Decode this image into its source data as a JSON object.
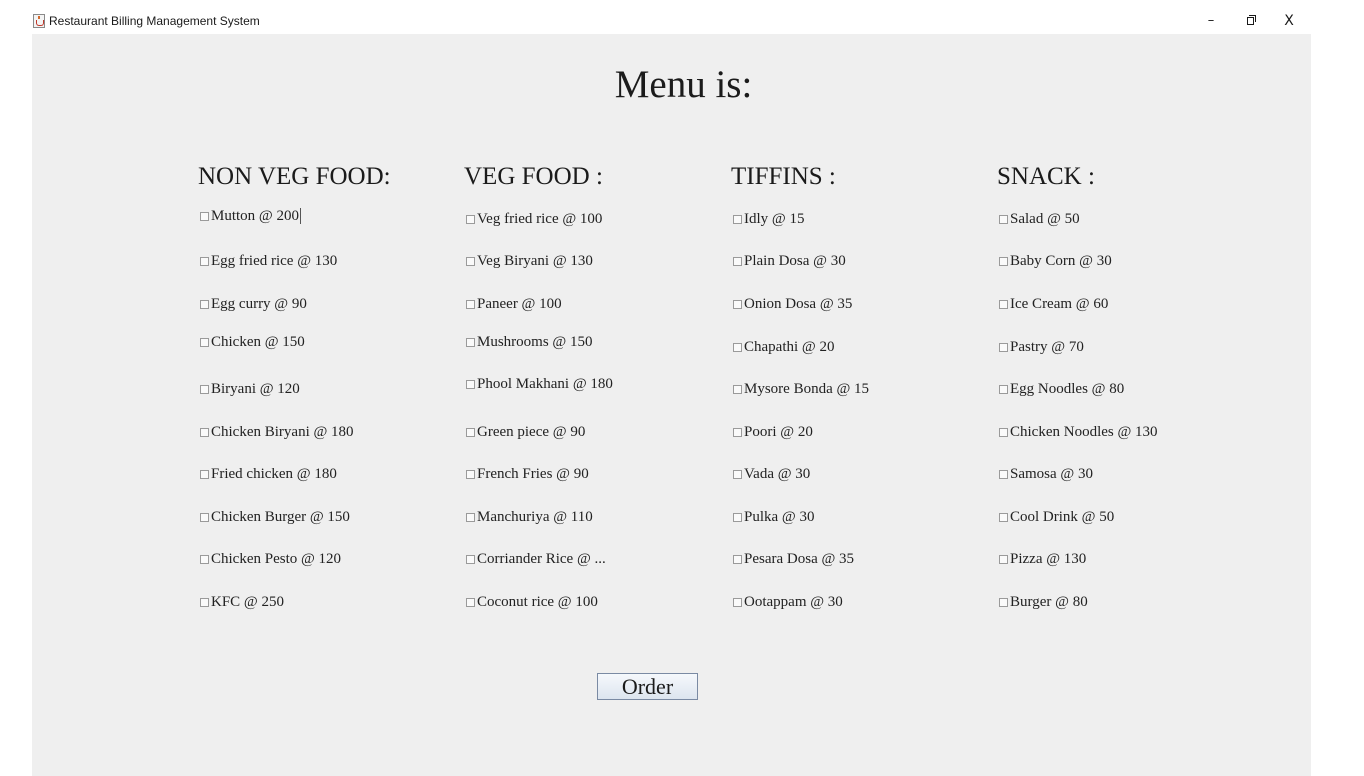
{
  "window": {
    "title": "Restaurant Billing Management System",
    "minimize_glyph": "–",
    "close_glyph": "X",
    "app_icon": "java-cup-icon"
  },
  "menu_title": "Menu is:",
  "columns": [
    {
      "header": "NON VEG FOOD:",
      "items": [
        "Mutton @ 200",
        "Egg fried rice @ 130",
        "Egg curry @ 90",
        "Chicken @ 150",
        "Biryani @ 120",
        "Chicken Biryani @ 180",
        "Fried chicken @ 180",
        "Chicken Burger @ 150",
        "Chicken Pesto @ 120",
        "KFC @ 250"
      ]
    },
    {
      "header": "VEG FOOD :",
      "items": [
        "Veg fried rice @ 100",
        "Veg Biryani @ 130",
        "Paneer @ 100",
        "Mushrooms @ 150",
        "Phool Makhani @ 180",
        "Green piece @ 90",
        "French Fries @ 90",
        "Manchuriya @ 110",
        "Corriander Rice @ ...",
        "Coconut rice @ 100"
      ]
    },
    {
      "header": "TIFFINS :",
      "items": [
        "Idly @ 15",
        "Plain Dosa @ 30",
        "Onion Dosa @ 35",
        "Chapathi @ 20",
        "Mysore Bonda @ 15",
        "Poori @ 20",
        "Vada @ 30",
        "Pulka @ 30",
        "Pesara Dosa @ 35",
        "Ootappam @ 30"
      ]
    },
    {
      "header": "SNACK :",
      "items": [
        "Salad @ 50",
        "Baby Corn @ 30",
        "Ice Cream @ 60",
        "Pastry @ 70",
        "Egg Noodles @ 80",
        "Chicken Noodles @ 130",
        "Samosa @ 30",
        "Cool Drink @ 50",
        "Pizza @ 130",
        "Burger @ 80"
      ]
    }
  ],
  "order_button": "Order"
}
